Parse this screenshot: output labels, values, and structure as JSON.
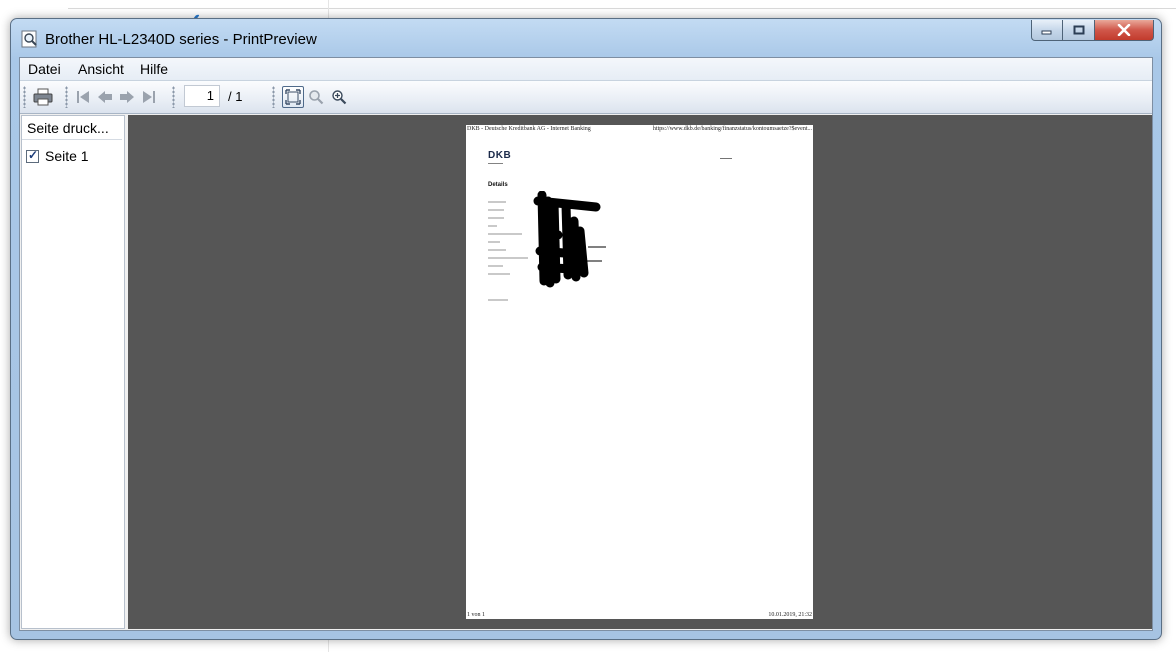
{
  "window": {
    "title": "Brother HL-L2340D series - PrintPreview",
    "icon": "print-preview-magnifier-icon"
  },
  "menu": [
    "Datei",
    "Ansicht",
    "Hilfe"
  ],
  "toolbar": {
    "page_current": "1",
    "page_total": "/ 1",
    "icons": [
      "print-icon",
      "first-page-icon",
      "previous-page-icon",
      "next-page-icon",
      "last-page-icon",
      "fit-page-icon",
      "zoom-out-icon",
      "zoom-in-icon"
    ]
  },
  "side_panel": {
    "header": "Seite druck...",
    "pages": [
      {
        "label": "Seite 1",
        "checked": true
      }
    ]
  },
  "document": {
    "header_left": "DKB - Deutsche Kreditbank AG - Internet Banking",
    "header_right": "https://www.dkb.de/banking/finanzstatus/kontoumsaetze?$event...",
    "footer_left": "1 von 1",
    "footer_right": "10.01.2019, 21:32",
    "logo": "DKB",
    "section_title": "Details"
  },
  "colors": {
    "preview_background": "#565656",
    "titlebar": "#b0cdeb",
    "close_button": "#c9473a"
  }
}
